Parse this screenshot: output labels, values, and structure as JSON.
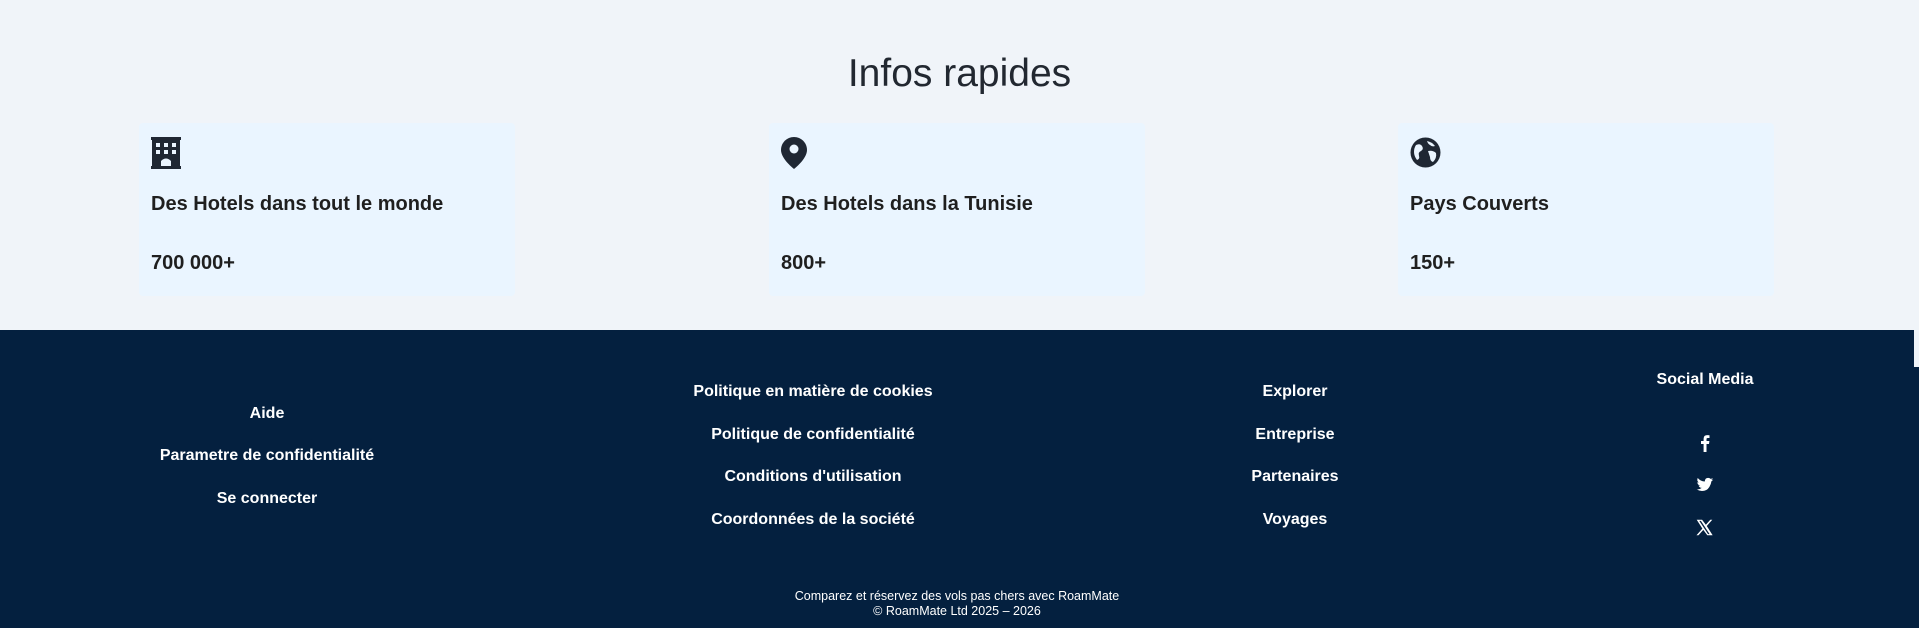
{
  "stats": {
    "title": "Infos rapides",
    "cards": [
      {
        "icon": "hotel-building-icon",
        "label": "Des Hotels dans tout le monde",
        "value": "700 000+"
      },
      {
        "icon": "map-pin-icon",
        "label": "Des Hotels dans la Tunisie",
        "value": "800+"
      },
      {
        "icon": "globe-icon",
        "label": "Pays Couverts",
        "value": "150+"
      }
    ]
  },
  "footer": {
    "col1": [
      "Aide",
      "Parametre de confidentialité",
      "Se connecter"
    ],
    "col2": [
      "Politique en matière de cookies",
      "Politique de confidentialité",
      "Conditions d'utilisation",
      "Coordonnées de la société"
    ],
    "col3": [
      "Explorer",
      "Entreprise",
      "Partenaires",
      "Voyages"
    ],
    "social": {
      "heading": "Social Media",
      "icons": [
        "facebook-icon",
        "twitter-icon",
        "x-icon"
      ]
    },
    "tagline": "Comparez et réservez des vols pas chers avec RoamMate",
    "copyright": "© RoamMate Ltd 2025 – 2026"
  }
}
